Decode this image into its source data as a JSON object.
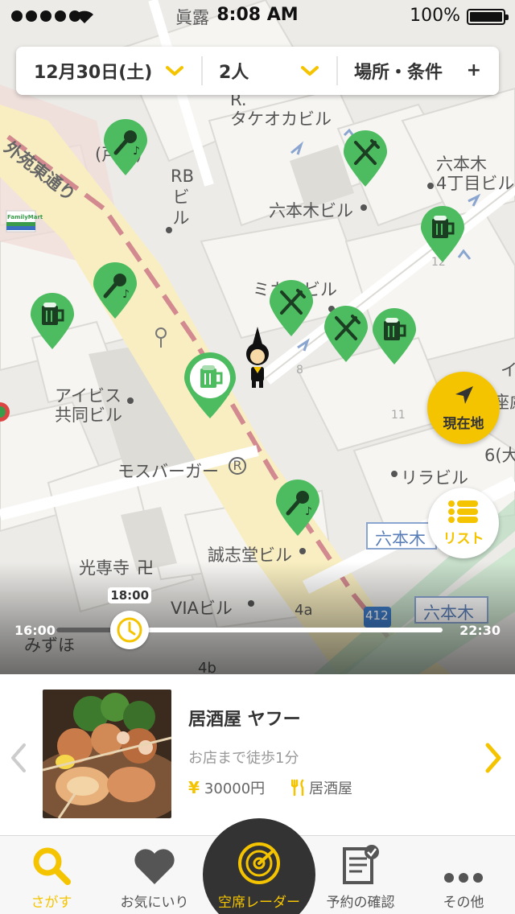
{
  "status_bar": {
    "time": "8:08 AM",
    "battery": "100%"
  },
  "filter": {
    "date": "12月30日(土)",
    "people": "2人",
    "conditions": "場所・条件"
  },
  "map": {
    "labels": {
      "street_vertical": "外苑東通り",
      "r_takeo": "R.\nタケオカビル",
      "rb_building": "RBビル",
      "line_partial": "(戸線)",
      "roppongi_bldg": "六本木ビル",
      "roppongi_4": "六本木\n4丁目ビル",
      "mika_bldg": "ミカドビル",
      "ibis": "アイビス\n共同ビル",
      "mos": "モスバーガー",
      "seishido": "誠志堂ビル",
      "kosenji": "光専寺",
      "via": "VIAビル",
      "mizuho": "みずほ",
      "rirabiru": "リラビル",
      "roppongi_station1": "六本木",
      "roppongi_station2": "六本木",
      "top_truncated": "眞露",
      "num_8": "8",
      "num_11": "11",
      "num_12": "12",
      "num_4a": "4a",
      "num_4b": "4b",
      "num_412": "412",
      "edge_6": "6(大",
      "edge_i": "イ",
      "edge_ku": "座慮",
      "familymart": "FamilyMart"
    }
  },
  "buttons": {
    "current_location": "現在地",
    "list": "リスト"
  },
  "slider": {
    "min": "16:00",
    "max": "22:30",
    "current": "18:00",
    "fraction": 0.19
  },
  "card": {
    "name": "居酒屋 ヤフー",
    "walk": "お店まで徒歩1分",
    "price": "30000円",
    "genre": "居酒屋"
  },
  "tabs": {
    "search": "さがす",
    "favorites": "お気にいり",
    "radar": "空席レーダー",
    "reservations": "予約の確認",
    "other": "その他"
  },
  "colors": {
    "accent": "#f5c400",
    "pin_green": "#4dbb5f",
    "dark": "#333333"
  }
}
